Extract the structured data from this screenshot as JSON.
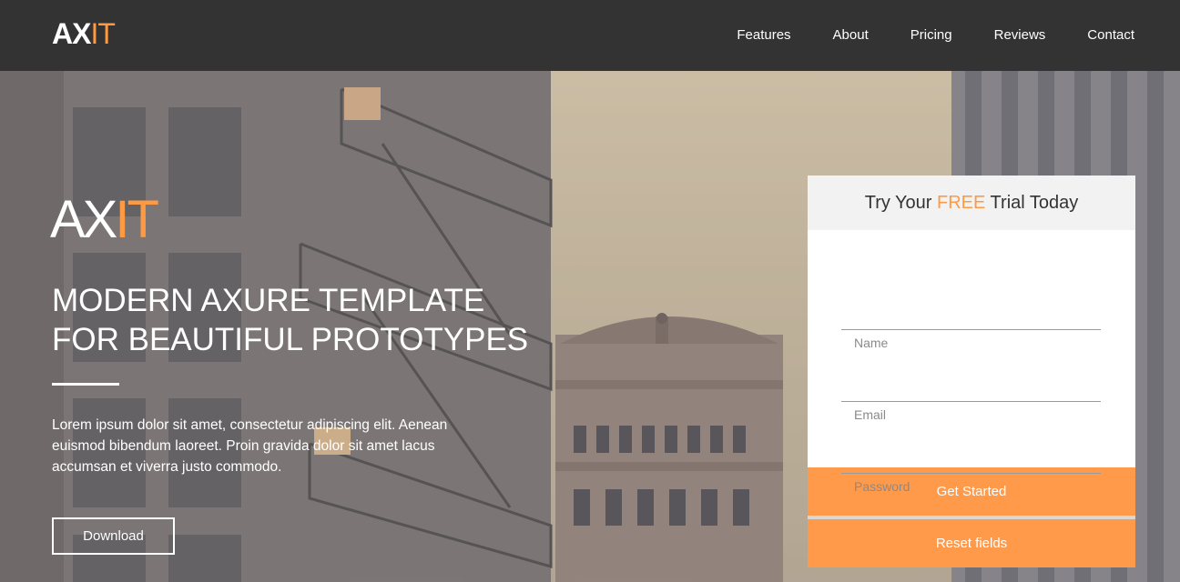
{
  "brand": {
    "part1": "AX",
    "part2": "IT"
  },
  "nav": {
    "items": [
      {
        "label": "Features"
      },
      {
        "label": "About"
      },
      {
        "label": "Pricing"
      },
      {
        "label": "Reviews"
      },
      {
        "label": "Contact"
      }
    ]
  },
  "hero": {
    "logo_part1": "AX",
    "logo_part2": "IT",
    "headline_line1": "MODERN AXURE TEMPLATE",
    "headline_line2": "FOR BEAUTIFUL PROTOTYPES",
    "lead": "Lorem ipsum dolor sit amet, consectetur adipiscing elit. Aenean euismod bibendum laoreet. Proin gravida dolor sit amet lacus accumsan et viverra justo commodo.",
    "download_label": "Download"
  },
  "trial": {
    "title_before": "Try Your ",
    "title_highlight": "FREE",
    "title_after": " Trial Today",
    "name_placeholder": "Name",
    "email_placeholder": "Email",
    "password_placeholder": "Password",
    "submit_label": "Get Started",
    "reset_label": "Reset fields"
  },
  "colors": {
    "accent": "#ff9a44",
    "navbar": "#333333",
    "button": "#ff9a4a"
  }
}
